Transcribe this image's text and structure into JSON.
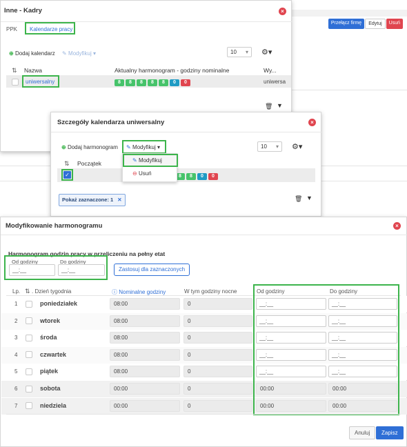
{
  "background": {
    "buttons": [
      "Przełącz firmę",
      "Edytuj",
      "Usuń"
    ]
  },
  "panel1": {
    "title": "Inne - Kadry",
    "tabs": [
      "PPK",
      "Kalendarze pracy"
    ],
    "add_label": "Dodaj kalendarz",
    "modify_label": "Modyfikuj",
    "page_size": "10",
    "columns": [
      "Nazwa",
      "Aktualny harmonogram - godziny nominalne",
      "Wy..."
    ],
    "row": {
      "name": "uniwersalny",
      "chips": [
        "8",
        "8",
        "8",
        "8",
        "8",
        "0",
        "0"
      ],
      "extra": "uniwersa"
    }
  },
  "panel2": {
    "title": "Szczegóły kalendarza uniwersalny",
    "add_label": "Dodaj harmonogram",
    "modify_label": "Modyfikuj",
    "page_size": "10",
    "column": "Początek",
    "menu": [
      "Modyfikuj",
      "Usuń"
    ],
    "row_chips": [
      "8",
      "8",
      "0",
      "0"
    ],
    "filter_label": "Pokaż zaznaczone: 1"
  },
  "panel3": {
    "title": "Modyfikowanie harmonogramu",
    "section": "Harmonogram godzin pracy w przeliczeniu na pełny etat",
    "od_label": "Od godziny",
    "do_label": "Do godziny",
    "time_placeholder": "__:__",
    "apply_label": "Zastosuj dla zaznaczonych",
    "columns": [
      "Lp.",
      "Dzień tygodnia",
      "Nominalne godziny",
      "W tym godziny nocne",
      "Od godziny",
      "Do godziny"
    ],
    "rows": [
      {
        "lp": "1",
        "day": "poniedziałek",
        "nominal": "08:00",
        "night": "0",
        "od": "__:__",
        "do": "__:__"
      },
      {
        "lp": "2",
        "day": "wtorek",
        "nominal": "08:00",
        "night": "0",
        "od": "__:__",
        "do": "__:__"
      },
      {
        "lp": "3",
        "day": "środa",
        "nominal": "08:00",
        "night": "0",
        "od": "__:__",
        "do": "__:__"
      },
      {
        "lp": "4",
        "day": "czwartek",
        "nominal": "08:00",
        "night": "0",
        "od": "__:__",
        "do": "__:__"
      },
      {
        "lp": "5",
        "day": "piątek",
        "nominal": "08:00",
        "night": "0",
        "od": "__:__",
        "do": "__:__"
      },
      {
        "lp": "6",
        "day": "sobota",
        "nominal": "00:00",
        "night": "0",
        "od": "00:00",
        "do": "00:00"
      },
      {
        "lp": "7",
        "day": "niedziela",
        "nominal": "00:00",
        "night": "0",
        "od": "00:00",
        "do": "00:00"
      }
    ],
    "cancel_label": "Anuluj",
    "save_label": "Zapisz"
  },
  "colors": {
    "accent": "#2f6fd6",
    "highlight": "#3cb44b",
    "danger": "#e0454f"
  }
}
